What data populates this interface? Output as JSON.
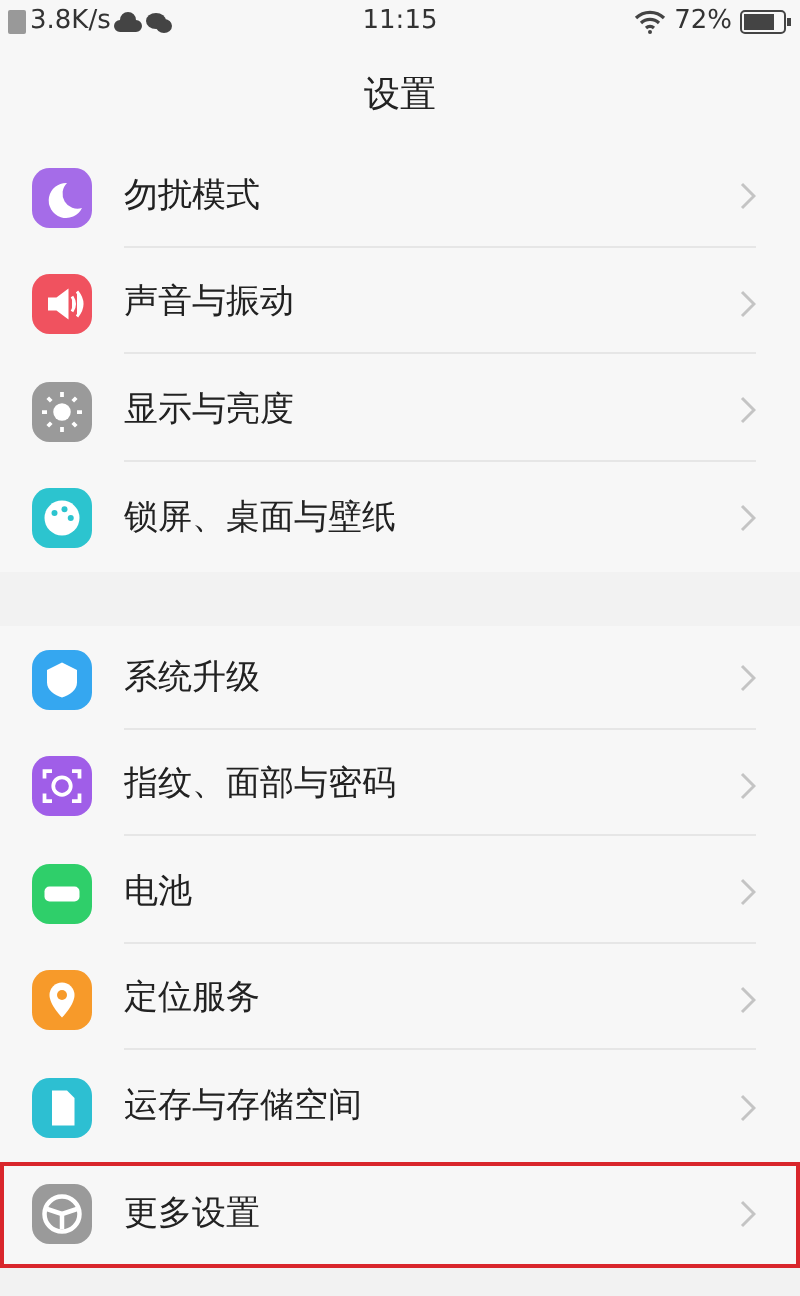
{
  "status_bar": {
    "speed": "3.8K/s",
    "time": "11:15",
    "battery": "72%"
  },
  "title": "设置",
  "groups": [
    {
      "items": [
        {
          "label": "勿扰模式",
          "color": "#a56ce8",
          "highlighted": false
        },
        {
          "label": "声音与振动",
          "color": "#f0525f",
          "highlighted": false
        },
        {
          "label": "显示与亮度",
          "color": "#9a9a9a",
          "highlighted": false
        },
        {
          "label": "锁屏、桌面与壁纸",
          "color": "#2cc4cf",
          "highlighted": false
        }
      ]
    },
    {
      "items": [
        {
          "label": "系统升级",
          "color": "#35a7f0",
          "highlighted": false
        },
        {
          "label": "指纹、面部与密码",
          "color": "#a05ee8",
          "highlighted": false
        },
        {
          "label": "电池",
          "color": "#2fcf6a",
          "highlighted": false
        },
        {
          "label": "定位服务",
          "color": "#f79a2a",
          "highlighted": false
        },
        {
          "label": "运存与存储空间",
          "color": "#2dbfd2",
          "highlighted": false
        },
        {
          "label": "更多设置",
          "color": "#9a9a9a",
          "highlighted": true
        }
      ]
    }
  ]
}
